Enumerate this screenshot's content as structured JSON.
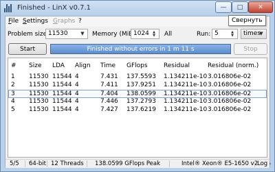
{
  "window": {
    "title": "Finished - LinX v0.7.1"
  },
  "titlebar_buttons": {
    "minimize": "—",
    "maximize": "□",
    "close": "✕"
  },
  "tooltip": "Свернуть",
  "menu": [
    {
      "label": "File",
      "accel": "F",
      "enabled": true
    },
    {
      "label": "Settings",
      "accel": "S",
      "enabled": true
    },
    {
      "label": "Graphs",
      "accel": "G",
      "enabled": false
    },
    {
      "label": "?",
      "accel": "",
      "enabled": true
    }
  ],
  "controls": {
    "problem_size_label": "Problem size:",
    "problem_size_value": "11530",
    "memory_label": "Memory (MiB):",
    "memory_value": "1024",
    "memory_extra": "All",
    "run_label": "Run:",
    "run_value": "5",
    "run_unit": "times",
    "start_label": "Start",
    "stop_label": "Stop",
    "status_text": "Finished without errors in 1 m 11 s",
    "progress": 1.0
  },
  "table": {
    "columns": [
      "#",
      "Size",
      "LDA",
      "Align",
      "Time",
      "GFlops",
      "Residual",
      "Residual (norm.)"
    ],
    "rows": [
      [
        "1",
        "11530",
        "11544",
        "4",
        "7.431",
        "137.5593",
        "1.134211e-10",
        "3.016806e-02"
      ],
      [
        "2",
        "11530",
        "11544",
        "4",
        "7.411",
        "137.9251",
        "1.134211e-10",
        "3.016806e-02"
      ],
      [
        "3",
        "11530",
        "11544",
        "4",
        "7.404",
        "138.0599",
        "1.134211e-10",
        "3.016806e-02"
      ],
      [
        "4",
        "11530",
        "11544",
        "4",
        "7.446",
        "137.2793",
        "1.134211e-10",
        "3.016806e-02"
      ],
      [
        "5",
        "11530",
        "11544",
        "4",
        "7.427",
        "137.6219",
        "1.134211e-10",
        "3.016806e-02"
      ]
    ],
    "selected_row": 2
  },
  "statusbar": {
    "runs": "5/5",
    "arch": "64-bit",
    "threads": "12 Threads",
    "peak": "138.0599 GFlops Peak",
    "cpu": "Intel® Xeon® E5-1650 v2",
    "log": "Log"
  }
}
